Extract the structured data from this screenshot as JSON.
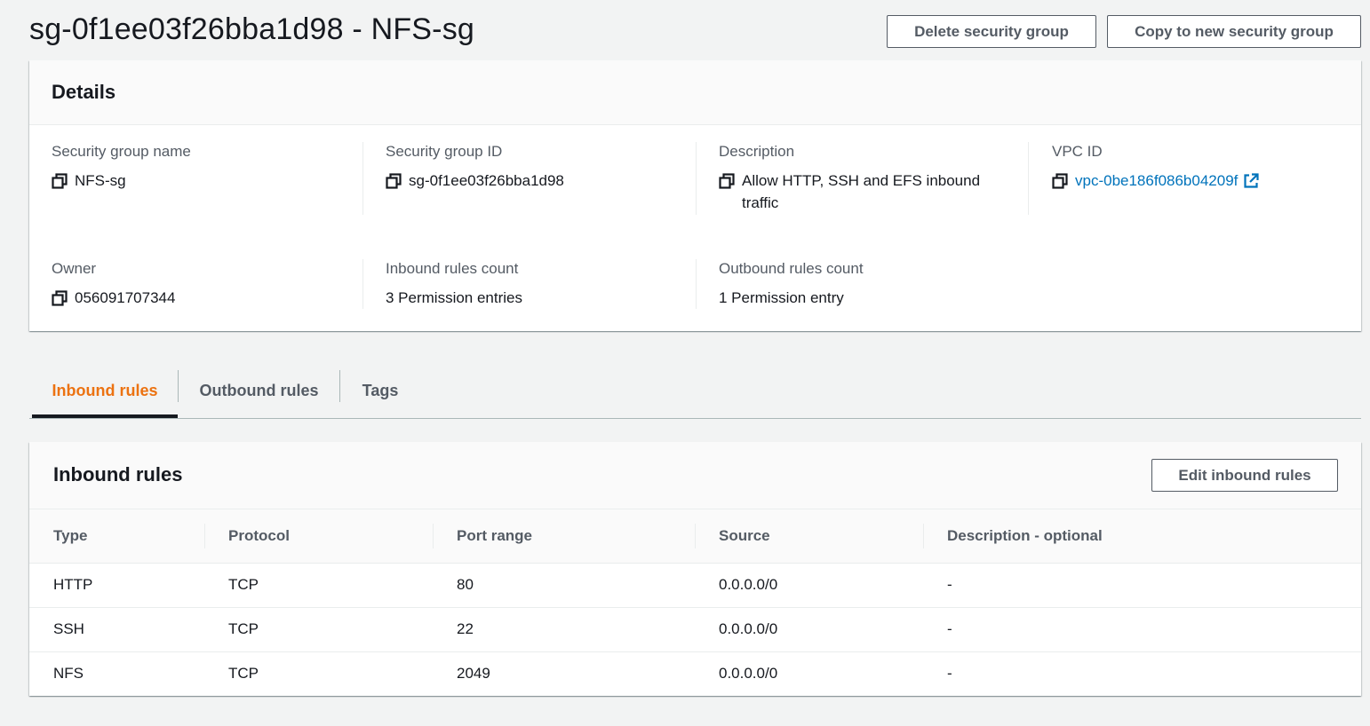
{
  "header": {
    "title": "sg-0f1ee03f26bba1d98 - NFS-sg",
    "delete_label": "Delete security group",
    "copy_label": "Copy to new security group"
  },
  "details": {
    "title": "Details",
    "fields": {
      "sg_name": {
        "label": "Security group name",
        "value": "NFS-sg"
      },
      "sg_id": {
        "label": "Security group ID",
        "value": "sg-0f1ee03f26bba1d98"
      },
      "description": {
        "label": "Description",
        "value": "Allow HTTP, SSH and EFS inbound traffic"
      },
      "vpc_id": {
        "label": "VPC ID",
        "value": "vpc-0be186f086b04209f"
      },
      "owner": {
        "label": "Owner",
        "value": "056091707344"
      },
      "inbound_count": {
        "label": "Inbound rules count",
        "value": "3 Permission entries"
      },
      "outbound_count": {
        "label": "Outbound rules count",
        "value": "1 Permission entry"
      }
    }
  },
  "tabs": [
    {
      "label": "Inbound rules",
      "active": true
    },
    {
      "label": "Outbound rules",
      "active": false
    },
    {
      "label": "Tags",
      "active": false
    }
  ],
  "inbound_rules": {
    "title": "Inbound rules",
    "edit_label": "Edit inbound rules",
    "columns": [
      "Type",
      "Protocol",
      "Port range",
      "Source",
      "Description - optional"
    ],
    "rows": [
      [
        "HTTP",
        "TCP",
        "80",
        "0.0.0.0/0",
        "-"
      ],
      [
        "SSH",
        "TCP",
        "22",
        "0.0.0.0/0",
        "-"
      ],
      [
        "NFS",
        "TCP",
        "2049",
        "0.0.0.0/0",
        "-"
      ]
    ]
  },
  "colors": {
    "accent": "#ec7211",
    "link": "#0073bb",
    "text": "#16191f",
    "muted": "#545b64",
    "background": "#f2f3f3"
  },
  "icons": {
    "copy": "copy-icon",
    "external_link": "external-link-icon"
  }
}
